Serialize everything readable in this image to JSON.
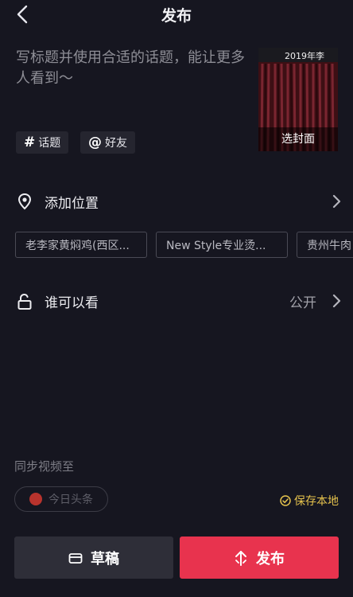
{
  "header": {
    "title": "发布",
    "back_icon": "chevron-left-icon"
  },
  "composer": {
    "caption_placeholder": "写标题并使用合适的话题，能让更多人看到～",
    "cover_label": "选封面",
    "cover_overlay_text": "2019年李",
    "hashtag_chip": {
      "symbol": "#",
      "label": "话题"
    },
    "mention_chip": {
      "symbol": "@",
      "label": "好友"
    }
  },
  "location": {
    "label": "添加位置",
    "icon": "location-pin-icon",
    "suggestions": [
      "老李家黄焖鸡(西区...",
      "New Style专业烫...",
      "贵州牛肉"
    ]
  },
  "visibility": {
    "label": "谁可以看",
    "value": "公开",
    "icon": "unlock-icon"
  },
  "sync": {
    "label": "同步视频至",
    "toutiao_label": "今日头条",
    "save_local_label": "保存本地"
  },
  "actions": {
    "draft_label": "草稿",
    "publish_label": "发布"
  },
  "colors": {
    "background": "#161620",
    "publish_red": "#e8334e",
    "save_local_yellow": "#e6c34d"
  }
}
